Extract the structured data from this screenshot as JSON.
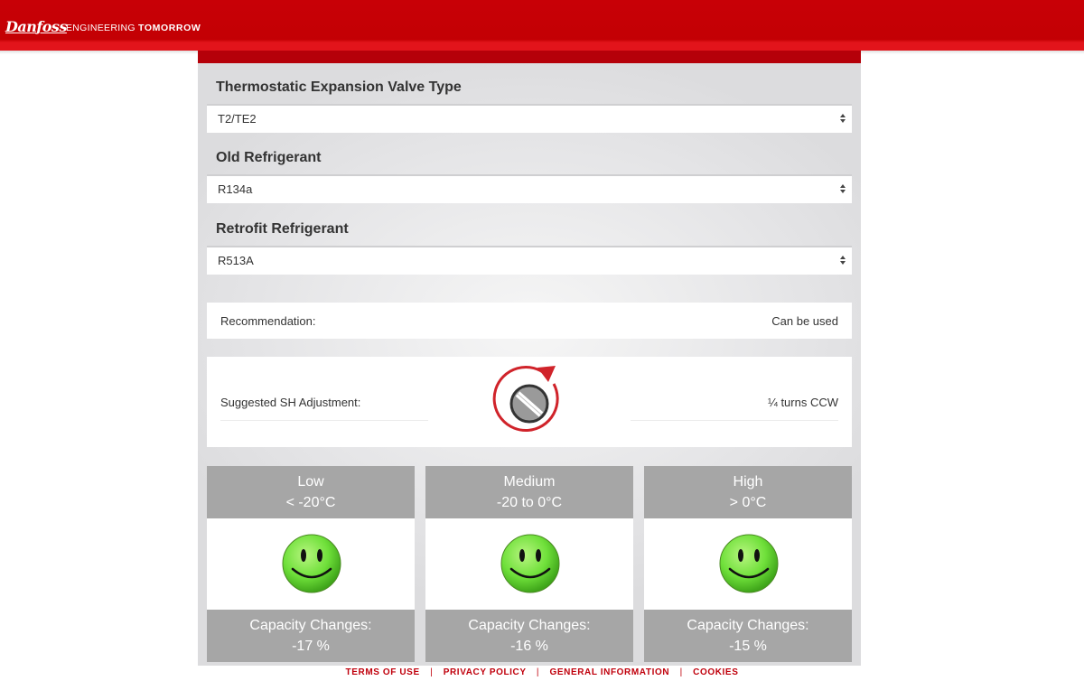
{
  "header": {
    "logo": "Danfoss",
    "tagline_normal": "ENGINEERING",
    "tagline_bold": "TOMORROW"
  },
  "form": {
    "valve_type": {
      "label": "Thermostatic Expansion Valve Type",
      "value": "T2/TE2"
    },
    "old_refrigerant": {
      "label": "Old Refrigerant",
      "value": "R134a"
    },
    "retrofit_refrigerant": {
      "label": "Retrofit Refrigerant",
      "value": "R513A"
    }
  },
  "recommendation": {
    "label": "Recommendation:",
    "value": "Can be used"
  },
  "sh_adjustment": {
    "label": "Suggested SH Adjustment:",
    "value": "¼ turns CCW",
    "icon": "ccw-rotation-dial-icon"
  },
  "ranges": [
    {
      "name": "Low",
      "temp": "< -20°C",
      "capacity_label": "Capacity Changes:",
      "capacity_value": "-17 %",
      "status": "smiley-happy-icon"
    },
    {
      "name": "Medium",
      "temp": "-20 to 0°C",
      "capacity_label": "Capacity Changes:",
      "capacity_value": "-16 %",
      "status": "smiley-happy-icon"
    },
    {
      "name": "High",
      "temp": "> 0°C",
      "capacity_label": "Capacity Changes:",
      "capacity_value": "-15 %",
      "status": "smiley-happy-icon"
    }
  ],
  "footer": {
    "links": [
      "TERMS OF USE",
      "PRIVACY POLICY",
      "GENERAL INFORMATION",
      "COOKIES"
    ],
    "separator": "|"
  },
  "colors": {
    "brand_red": "#c80006",
    "panel_red": "#b50009",
    "header_grey": "#a6a6a6",
    "smiley_green": "#6fe03a"
  }
}
